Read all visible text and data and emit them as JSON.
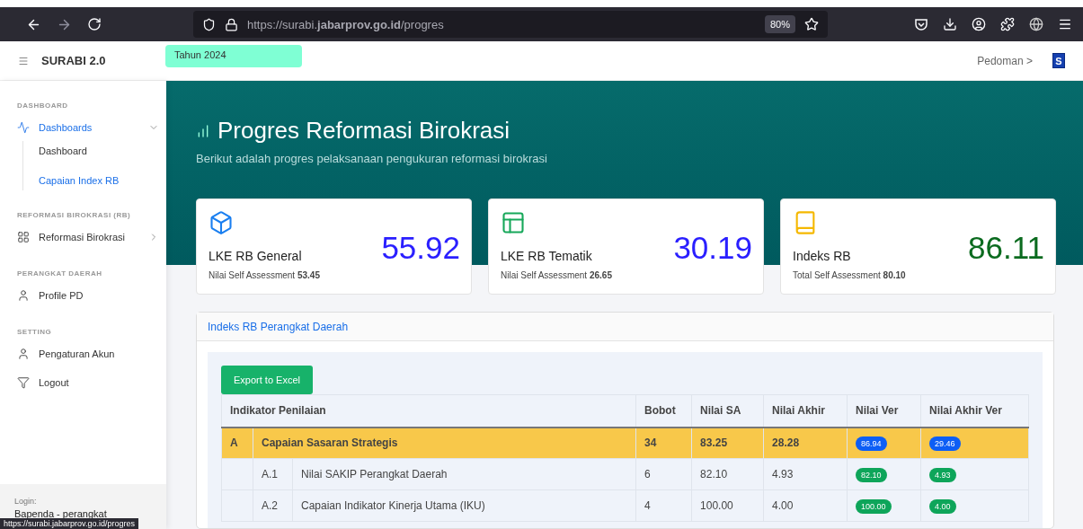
{
  "browser": {
    "url": "https://surabi.**jabarprov.go.id**/progres",
    "zoom": "80%",
    "status_url": "https://surabi.jabarprov.go.id/progres"
  },
  "header": {
    "app_name": "SURABI 2.0",
    "year": "Tahun 2024",
    "link": "Pedoman",
    "link_caret": ">",
    "logo": "S"
  },
  "sidebar": {
    "sections": [
      {
        "title": "DASHBOARD",
        "items": [
          {
            "label": "Dashboards",
            "selected": true,
            "expanded": true,
            "children": [
              {
                "label": "Dashboard",
                "selected": false
              },
              {
                "label": "Capaian Index RB",
                "selected": true
              }
            ]
          }
        ]
      },
      {
        "title": "REFORMASI BIROKRASI (RB)",
        "items": [
          {
            "label": "Reformasi Birokrasi",
            "selected": false,
            "expanded": false
          }
        ]
      },
      {
        "title": "PERANGKAT DAERAH",
        "items": [
          {
            "label": "Profile PD",
            "selected": false
          }
        ]
      },
      {
        "title": "SETTING",
        "items": [
          {
            "label": "Pengaturan Akun",
            "selected": false
          },
          {
            "label": "Logout",
            "selected": false
          }
        ]
      }
    ],
    "login_label": "Login:",
    "login_user": "Bapenda - perangkat"
  },
  "hero": {
    "title": "Progres Reformasi Birokrasi",
    "subtitle": "Berikut adalah progres pelaksanaan pengukuran reformasi birokrasi"
  },
  "cards": [
    {
      "title": "LKE RB General",
      "value": "55.92",
      "color": "#2a1fff",
      "note": "Nilai Self Assessment **53.45**"
    },
    {
      "title": "LKE RB Tematik",
      "value": "30.19",
      "color": "#2a1fff",
      "note": "Nilai Self Assessment **26.65**"
    },
    {
      "title": "Indeks RB",
      "value": "86.11",
      "color": "#0b6b1f",
      "note": "Total Self Assessment **80.10**"
    }
  ],
  "panel": {
    "title": "Indeks RB Perangkat Daerah",
    "export_button": "Export to Excel",
    "columns": [
      "Indikator Penilaian",
      "Bobot",
      "Nilai SA",
      "Nilai Akhir",
      "Nilai Ver",
      "Nilai Akhir Ver"
    ],
    "rows": [
      {
        "kind": "group",
        "code": "A",
        "name": "Capaian Sasaran Strategis",
        "bobot": "34",
        "nilai_sa": "83.25",
        "nilai_akhir": "28.28",
        "nilai_ver": "86.94",
        "nilai_akhir_ver": "29.46"
      },
      {
        "kind": "item",
        "code": "A.1",
        "name": "Nilai SAKIP Perangkat Daerah",
        "bobot": "6",
        "nilai_sa": "82.10",
        "nilai_akhir": "4.93",
        "nilai_ver": "82.10",
        "nilai_akhir_ver": "4.93"
      },
      {
        "kind": "item",
        "code": "A.2",
        "name": "Capaian Indikator Kinerja Utama (IKU)",
        "bobot": "4",
        "nilai_sa": "100.00",
        "nilai_akhir": "4.00",
        "nilai_ver": "100.00",
        "nilai_akhir_ver": "4.00"
      }
    ]
  }
}
